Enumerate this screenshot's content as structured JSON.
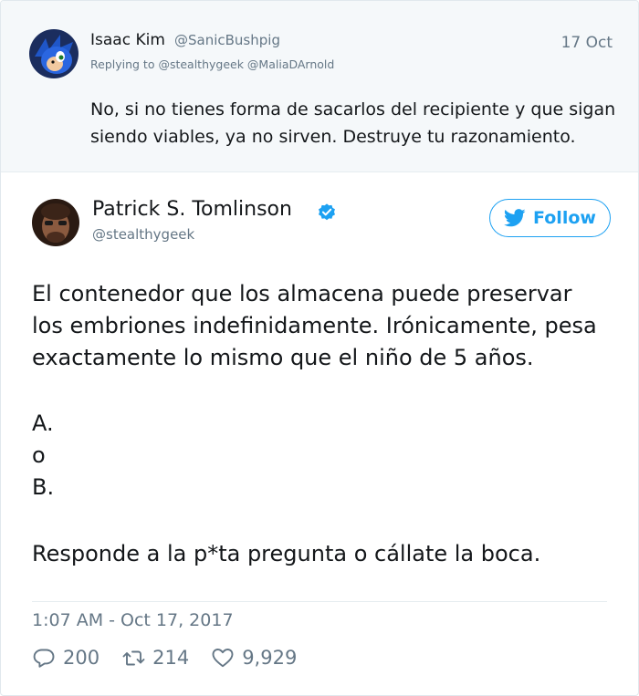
{
  "reply": {
    "name": "Isaac Kim",
    "handle": "@SanicBushpig",
    "date": "17 Oct",
    "replying_to": "Replying to @stealthygeek @MaliaDArnold",
    "text_lines": [
      "No, si no tienes forma de sacarlos del recipiente y que sigan",
      "siendo viables, ya no sirven. Destruye tu razonamiento."
    ]
  },
  "tweet": {
    "name": "Patrick S. Tomlinson",
    "handle": "@stealthygeek",
    "follow_label": "Follow",
    "body_lines": [
      "El contenedor que los almacena puede preservar",
      "los embriones indefinidamente. Irónicamente, pesa",
      "exactamente lo mismo que el niño de 5 años.",
      "A.",
      "o",
      "B.",
      "Responde a la p*ta pregunta o cállate la boca."
    ],
    "timestamp": "1:07 AM - Oct 17, 2017",
    "stats": {
      "replies": "200",
      "retweets": "214",
      "likes": "9,929"
    }
  },
  "colors": {
    "accent": "#1da1f2",
    "muted_text": "#657786",
    "reply_background": "#f5f8fa"
  },
  "icons": {
    "verified": "verified-badge-icon",
    "follow": "twitter-bird-icon",
    "reply": "reply-icon",
    "retweet": "retweet-icon",
    "like": "heart-icon"
  }
}
